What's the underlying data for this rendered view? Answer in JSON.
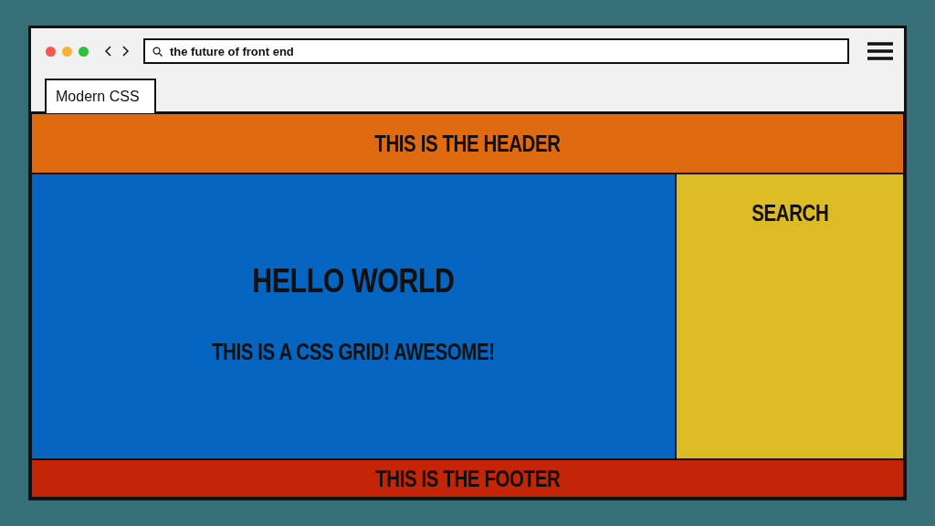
{
  "browser": {
    "address": "the future of front end",
    "tabs": [
      {
        "label": "Modern CSS",
        "selected": true
      }
    ]
  },
  "page": {
    "header": "THIS IS THE HEADER",
    "main": {
      "title": "HELLO WORLD",
      "text": "THIS IS A CSS GRID! AWESOME!"
    },
    "sidebar": {
      "title": "SEARCH"
    },
    "footer": "THIS IS THE FOOTER"
  }
}
